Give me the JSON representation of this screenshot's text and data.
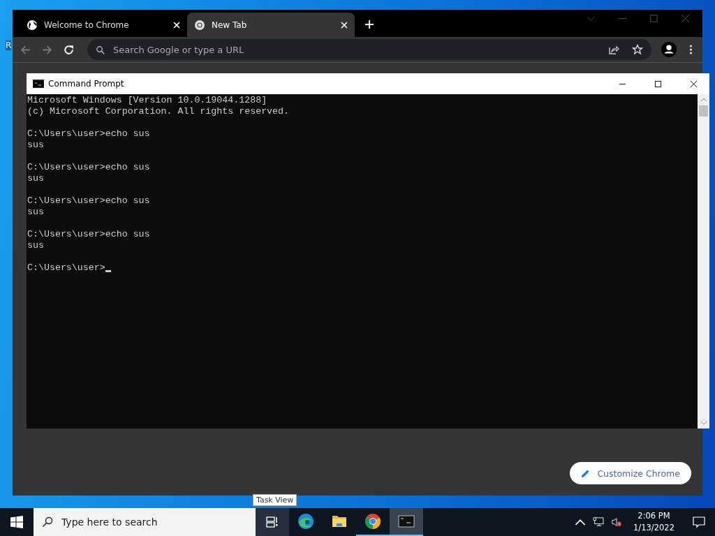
{
  "desktop": {
    "label": "R"
  },
  "browser": {
    "tabs": [
      {
        "kind": "page",
        "title": "Welcome to Chrome",
        "selected": false
      },
      {
        "kind": "newtab",
        "title": "New Tab",
        "selected": true
      }
    ],
    "omnibox": {
      "placeholder": "Search Google or type a URL"
    },
    "customize_button": "Customize Chrome"
  },
  "console": {
    "title": "Command Prompt",
    "blocks": [
      [
        "Microsoft Windows [Version 10.0.19044.1288]",
        "(c) Microsoft Corporation. All rights reserved."
      ],
      [
        "C:\\Users\\user>echo sus",
        "sus"
      ],
      [
        "C:\\Users\\user>echo sus",
        "sus"
      ],
      [
        "C:\\Users\\user>echo sus",
        "sus"
      ],
      [
        "C:\\Users\\user>echo sus",
        "sus"
      ],
      [
        "C:\\Users\\user>"
      ]
    ]
  },
  "taskbar": {
    "search_placeholder": "Type here to search",
    "tooltip": "Task View",
    "apps": [
      {
        "kind": "edge",
        "running": false,
        "selected": false
      },
      {
        "kind": "explorer",
        "running": false,
        "selected": false
      },
      {
        "kind": "chrome",
        "running": true,
        "selected": false
      },
      {
        "kind": "terminal",
        "running": true,
        "selected": true
      }
    ],
    "clock": {
      "time": "2:06 PM",
      "date": "1/13/2022"
    }
  }
}
